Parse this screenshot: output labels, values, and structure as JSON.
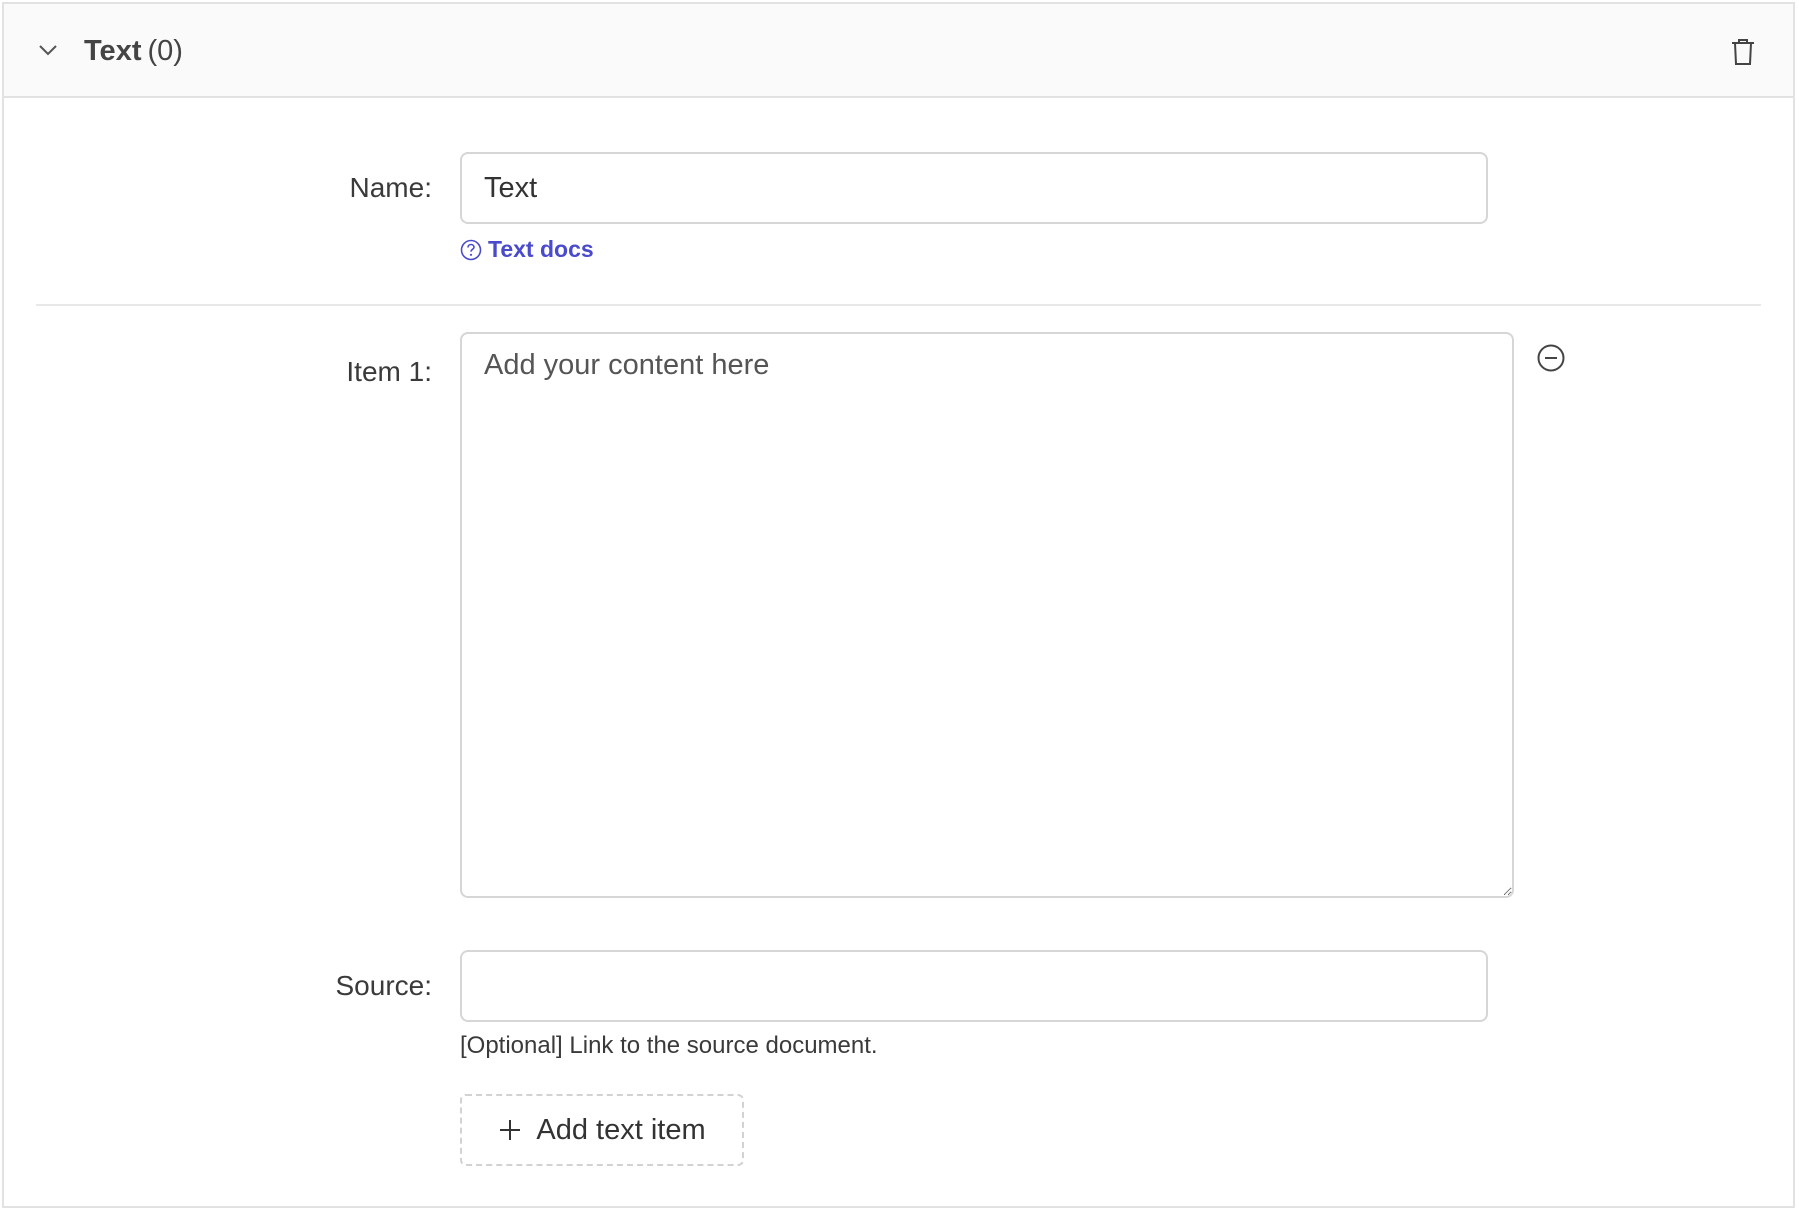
{
  "header": {
    "title": "Text",
    "count": "(0)",
    "collapse_icon": "chevron-down-icon",
    "delete_icon": "trash-icon"
  },
  "form": {
    "name": {
      "label": "Name",
      "value": "Text",
      "docs_link": "Text docs",
      "docs_icon": "question-circle-icon"
    },
    "items": [
      {
        "label": "Item 1",
        "placeholder": "Add your content here",
        "value": "",
        "remove_icon": "minus-circle-icon"
      }
    ],
    "source": {
      "label": "Source",
      "value": "",
      "help": "[Optional] Link to the source document."
    },
    "add_button": {
      "label": "Add text item",
      "icon": "plus-icon"
    }
  },
  "colors": {
    "link": "#4a4acc",
    "border": "#d6d6d6",
    "header_bg": "#fafafa"
  }
}
